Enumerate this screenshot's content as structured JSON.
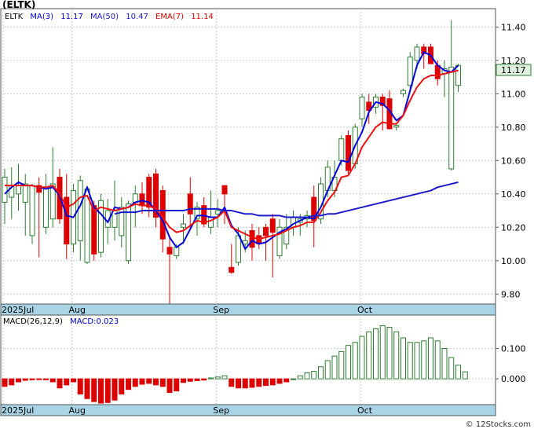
{
  "ticker_title": "(ELTK)",
  "legend": {
    "symbol": "ELTK",
    "ma3": "MA(3)",
    "ma3_value": "11.17",
    "ma50": "MA(50)",
    "ma50_value": "10.47",
    "ema7": "EMA(7)",
    "ema7_value": "11.14"
  },
  "price_tag": "11.17",
  "macd_legend": {
    "label": "MACD(26,12,9)",
    "value": "MACD:0.023"
  },
  "watermark": "© 12Stocks.com",
  "colors": {
    "up_candle": "#2e7d32",
    "down_candle": "#dd0000",
    "ma3_line": "#0000dd",
    "ma50_line": "#1a1acc",
    "ema7_line": "#ee1111",
    "axis_band": "#a8d4e6",
    "grid": "#cccccc",
    "price_tag_bg": "#dff0df"
  },
  "chart_data": [
    {
      "type": "candlestick",
      "title": "ELTK",
      "x_labels": [
        "2025Jul",
        "Aug",
        "Sep",
        "Oct"
      ],
      "y_ticks": [
        "9.80",
        "10.00",
        "10.20",
        "10.40",
        "10.60",
        "10.80",
        "11.00",
        "11.20",
        "11.40"
      ],
      "ylim": [
        9.74,
        11.51
      ],
      "grid": true,
      "ohlc": [
        {
          "date": "Jul 18",
          "o": 10.35,
          "h": 10.55,
          "l": 10.22,
          "c": 10.5
        },
        {
          "date": "Jul 21",
          "o": 10.38,
          "h": 10.56,
          "l": 10.25,
          "c": 10.45
        },
        {
          "date": "Jul 22",
          "o": 10.4,
          "h": 10.58,
          "l": 10.3,
          "c": 10.45
        },
        {
          "date": "Jul 23",
          "o": 10.35,
          "h": 10.52,
          "l": 10.15,
          "c": 10.46
        },
        {
          "date": "Jul 24",
          "o": 10.15,
          "h": 10.46,
          "l": 10.1,
          "c": 10.45
        },
        {
          "date": "Jul 25",
          "o": 10.45,
          "h": 10.5,
          "l": 10.02,
          "c": 10.41
        },
        {
          "date": "Jul 28",
          "o": 10.2,
          "h": 10.52,
          "l": 10.16,
          "c": 10.44
        },
        {
          "date": "Jul 29",
          "o": 10.25,
          "h": 10.68,
          "l": 10.2,
          "c": 10.46
        },
        {
          "date": "Jul 30",
          "o": 10.5,
          "h": 10.55,
          "l": 10.22,
          "c": 10.25
        },
        {
          "date": "Jul 31",
          "o": 10.38,
          "h": 10.52,
          "l": 10.01,
          "c": 10.1
        },
        {
          "date": "Aug 1",
          "o": 10.1,
          "h": 10.46,
          "l": 10.05,
          "c": 10.42
        },
        {
          "date": "Aug 4",
          "o": 10.12,
          "h": 10.51,
          "l": 10.0,
          "c": 10.48
        },
        {
          "date": "Aug 5",
          "o": 9.99,
          "h": 10.45,
          "l": 9.98,
          "c": 10.43
        },
        {
          "date": "Aug 6",
          "o": 10.33,
          "h": 10.36,
          "l": 10.0,
          "c": 10.04
        },
        {
          "date": "Aug 7",
          "o": 10.05,
          "h": 10.4,
          "l": 10.02,
          "c": 10.36
        },
        {
          "date": "Aug 8",
          "o": 10.2,
          "h": 10.37,
          "l": 10.1,
          "c": 10.3
        },
        {
          "date": "Aug 11",
          "o": 10.2,
          "h": 10.48,
          "l": 10.12,
          "c": 10.3
        },
        {
          "date": "Aug 12",
          "o": 10.15,
          "h": 10.38,
          "l": 10.08,
          "c": 10.32
        },
        {
          "date": "Aug 13",
          "o": 10.0,
          "h": 10.36,
          "l": 9.98,
          "c": 10.34
        },
        {
          "date": "Aug 14",
          "o": 10.35,
          "h": 10.45,
          "l": 10.2,
          "c": 10.4
        },
        {
          "date": "Aug 15",
          "o": 10.4,
          "h": 10.47,
          "l": 10.28,
          "c": 10.33
        },
        {
          "date": "Aug 18",
          "o": 10.5,
          "h": 10.52,
          "l": 10.26,
          "c": 10.32
        },
        {
          "date": "Aug 19",
          "o": 10.52,
          "h": 10.55,
          "l": 10.2,
          "c": 10.26
        },
        {
          "date": "Aug 20",
          "o": 10.42,
          "h": 10.45,
          "l": 10.05,
          "c": 10.13
        },
        {
          "date": "Aug 21",
          "o": 10.08,
          "h": 10.15,
          "l": 9.74,
          "c": 10.04
        },
        {
          "date": "Aug 22",
          "o": 10.03,
          "h": 10.1,
          "l": 10.01,
          "c": 10.08
        },
        {
          "date": "Aug 25",
          "o": 10.2,
          "h": 10.28,
          "l": 10.1,
          "c": 10.22
        },
        {
          "date": "Aug 26",
          "o": 10.4,
          "h": 10.5,
          "l": 10.2,
          "c": 10.28
        },
        {
          "date": "Aug 27",
          "o": 10.25,
          "h": 10.35,
          "l": 10.15,
          "c": 10.32
        },
        {
          "date": "Aug 28",
          "o": 10.33,
          "h": 10.38,
          "l": 10.2,
          "c": 10.22
        },
        {
          "date": "Aug 29",
          "o": 10.2,
          "h": 10.42,
          "l": 10.16,
          "c": 10.26
        },
        {
          "date": "Sep 2",
          "o": 10.28,
          "h": 10.37,
          "l": 10.2,
          "c": 10.3
        },
        {
          "date": "Sep 3",
          "o": 10.45,
          "h": 10.45,
          "l": 10.22,
          "c": 10.4
        },
        {
          "date": "Sep 4",
          "o": 9.96,
          "h": 10.1,
          "l": 9.92,
          "c": 9.93
        },
        {
          "date": "Sep 5",
          "o": 9.99,
          "h": 10.2,
          "l": 9.97,
          "c": 10.15
        },
        {
          "date": "Sep 8",
          "o": 10.1,
          "h": 10.18,
          "l": 10.05,
          "c": 10.12
        },
        {
          "date": "Sep 9",
          "o": 10.18,
          "h": 10.22,
          "l": 10.0,
          "c": 10.08
        },
        {
          "date": "Sep 10",
          "o": 10.15,
          "h": 10.2,
          "l": 10.07,
          "c": 10.1
        },
        {
          "date": "Sep 11",
          "o": 10.2,
          "h": 10.22,
          "l": 10.0,
          "c": 10.15
        },
        {
          "date": "Sep 12",
          "o": 10.25,
          "h": 10.28,
          "l": 9.9,
          "c": 10.17
        },
        {
          "date": "Sep 15",
          "o": 10.03,
          "h": 10.25,
          "l": 10.01,
          "c": 10.2
        },
        {
          "date": "Sep 16",
          "o": 10.1,
          "h": 10.28,
          "l": 10.07,
          "c": 10.2
        },
        {
          "date": "Sep 17",
          "o": 10.2,
          "h": 10.3,
          "l": 10.15,
          "c": 10.26
        },
        {
          "date": "Sep 18",
          "o": 10.23,
          "h": 10.28,
          "l": 10.15,
          "c": 10.25
        },
        {
          "date": "Sep 19",
          "o": 10.25,
          "h": 10.3,
          "l": 10.2,
          "c": 10.27
        },
        {
          "date": "Sep 22",
          "o": 10.38,
          "h": 10.45,
          "l": 10.08,
          "c": 10.24
        },
        {
          "date": "Sep 23",
          "o": 10.25,
          "h": 10.5,
          "l": 10.22,
          "c": 10.46
        },
        {
          "date": "Sep 24",
          "o": 10.42,
          "h": 10.6,
          "l": 10.38,
          "c": 10.56
        },
        {
          "date": "Sep 25",
          "o": 10.42,
          "h": 10.6,
          "l": 10.38,
          "c": 10.5
        },
        {
          "date": "Sep 26",
          "o": 10.6,
          "h": 10.75,
          "l": 10.57,
          "c": 10.73
        },
        {
          "date": "Sep 29",
          "o": 10.75,
          "h": 10.78,
          "l": 10.52,
          "c": 10.54
        },
        {
          "date": "Sep 30",
          "o": 10.58,
          "h": 10.82,
          "l": 10.55,
          "c": 10.8
        },
        {
          "date": "Oct 1",
          "o": 10.85,
          "h": 11.0,
          "l": 10.8,
          "c": 10.98
        },
        {
          "date": "Oct 2",
          "o": 10.95,
          "h": 11.0,
          "l": 10.82,
          "c": 10.9
        },
        {
          "date": "Oct 3",
          "o": 10.92,
          "h": 11.0,
          "l": 10.88,
          "c": 10.98
        },
        {
          "date": "Oct 6",
          "o": 10.98,
          "h": 11.0,
          "l": 10.78,
          "c": 10.93
        },
        {
          "date": "Oct 7",
          "o": 10.97,
          "h": 11.02,
          "l": 10.83,
          "c": 10.79
        },
        {
          "date": "Oct 8",
          "o": 10.8,
          "h": 10.82,
          "l": 10.78,
          "c": 10.81
        },
        {
          "date": "Oct 9",
          "o": 11.0,
          "h": 11.03,
          "l": 10.98,
          "c": 11.02
        },
        {
          "date": "Oct 10",
          "o": 11.05,
          "h": 11.25,
          "l": 11.02,
          "c": 11.22
        },
        {
          "date": "Oct 13",
          "o": 11.2,
          "h": 11.3,
          "l": 11.15,
          "c": 11.28
        },
        {
          "date": "Oct 14",
          "o": 11.28,
          "h": 11.3,
          "l": 11.15,
          "c": 11.24
        },
        {
          "date": "Oct 15",
          "o": 11.28,
          "h": 11.3,
          "l": 11.18,
          "c": 11.18
        },
        {
          "date": "Oct 16",
          "o": 11.17,
          "h": 11.2,
          "l": 11.05,
          "c": 11.09
        },
        {
          "date": "Oct 17",
          "o": 11.12,
          "h": 11.2,
          "l": 10.98,
          "c": 11.15
        },
        {
          "date": "Oct 20",
          "o": 10.55,
          "h": 11.44,
          "l": 10.54,
          "c": 11.16
        },
        {
          "date": "Oct 21",
          "o": 11.05,
          "h": 11.18,
          "l": 11.01,
          "c": 11.17
        }
      ],
      "series": [
        {
          "name": "MA(3)",
          "color": "#0000dd",
          "values": [
            10.4,
            10.44,
            10.47,
            10.45,
            10.45,
            10.44,
            10.43,
            10.44,
            10.39,
            10.27,
            10.26,
            10.33,
            10.44,
            10.32,
            10.28,
            10.23,
            10.32,
            10.31,
            10.32,
            10.35,
            10.36,
            10.35,
            10.3,
            10.24,
            10.14,
            10.08,
            10.11,
            10.19,
            10.27,
            10.27,
            10.26,
            10.26,
            10.32,
            10.21,
            10.16,
            10.07,
            10.12,
            10.1,
            10.11,
            10.14,
            10.17,
            10.19,
            10.22,
            10.24,
            10.26,
            10.25,
            10.32,
            10.42,
            10.51,
            10.6,
            10.59,
            10.69,
            10.77,
            10.89,
            10.95,
            10.94,
            10.9,
            10.84,
            10.87,
            11.02,
            11.17,
            11.25,
            11.23,
            11.17,
            11.14,
            11.13,
            11.17
          ]
        },
        {
          "name": "EMA(7)",
          "color": "#ee1111",
          "values": [
            10.45,
            10.45,
            10.45,
            10.45,
            10.45,
            10.44,
            10.44,
            10.45,
            10.4,
            10.32,
            10.34,
            10.38,
            10.39,
            10.3,
            10.32,
            10.31,
            10.3,
            10.31,
            10.32,
            10.34,
            10.33,
            10.33,
            10.31,
            10.26,
            10.2,
            10.17,
            10.18,
            10.21,
            10.24,
            10.23,
            10.24,
            10.26,
            10.3,
            10.2,
            10.18,
            10.16,
            10.14,
            10.13,
            10.14,
            10.15,
            10.16,
            10.18,
            10.2,
            10.21,
            10.23,
            10.23,
            10.29,
            10.36,
            10.41,
            10.5,
            10.51,
            10.58,
            10.68,
            10.74,
            10.8,
            10.83,
            10.82,
            10.82,
            10.87,
            10.96,
            11.04,
            11.09,
            11.11,
            11.11,
            11.12,
            11.13,
            11.14
          ]
        },
        {
          "name": "MA(50)",
          "color": "#1a1acc",
          "start_index": 16,
          "values": [
            10.28,
            10.29,
            10.29,
            10.29,
            10.3,
            10.3,
            10.3,
            10.3,
            10.3,
            10.3,
            10.3,
            10.31,
            10.31,
            10.31,
            10.31,
            10.31,
            10.3,
            10.3,
            10.29,
            10.28,
            10.28,
            10.27,
            10.27,
            10.27,
            10.27,
            10.26,
            10.26,
            10.26,
            10.26,
            10.27,
            10.27,
            10.28,
            10.28,
            10.29,
            10.3,
            10.31,
            10.32,
            10.33,
            10.34,
            10.35,
            10.36,
            10.37,
            10.38,
            10.39,
            10.4,
            10.41,
            10.42,
            10.44,
            10.45,
            10.46,
            10.47
          ]
        }
      ]
    },
    {
      "type": "bar",
      "title": "MACD(26,12,9)",
      "y_ticks": [
        "0.000",
        "0.100"
      ],
      "ylim": [
        -0.085,
        0.21
      ],
      "x_labels": [
        "2025Jul",
        "Aug",
        "Sep",
        "Oct"
      ],
      "values": [
        -0.025,
        -0.02,
        -0.01,
        -0.005,
        -0.003,
        -0.002,
        -0.003,
        -0.01,
        -0.03,
        -0.02,
        -0.01,
        -0.05,
        -0.065,
        -0.075,
        -0.08,
        -0.078,
        -0.07,
        -0.05,
        -0.035,
        -0.025,
        -0.018,
        -0.015,
        -0.02,
        -0.025,
        -0.045,
        -0.04,
        -0.012,
        -0.008,
        -0.006,
        -0.004,
        0.003,
        0.006,
        0.01,
        -0.025,
        -0.03,
        -0.03,
        -0.028,
        -0.025,
        -0.022,
        -0.02,
        -0.015,
        -0.01,
        0.0,
        0.01,
        0.02,
        0.025,
        0.04,
        0.06,
        0.075,
        0.09,
        0.11,
        0.12,
        0.14,
        0.155,
        0.165,
        0.175,
        0.17,
        0.155,
        0.135,
        0.12,
        0.12,
        0.125,
        0.135,
        0.125,
        0.1,
        0.07,
        0.045,
        0.023
      ]
    }
  ]
}
